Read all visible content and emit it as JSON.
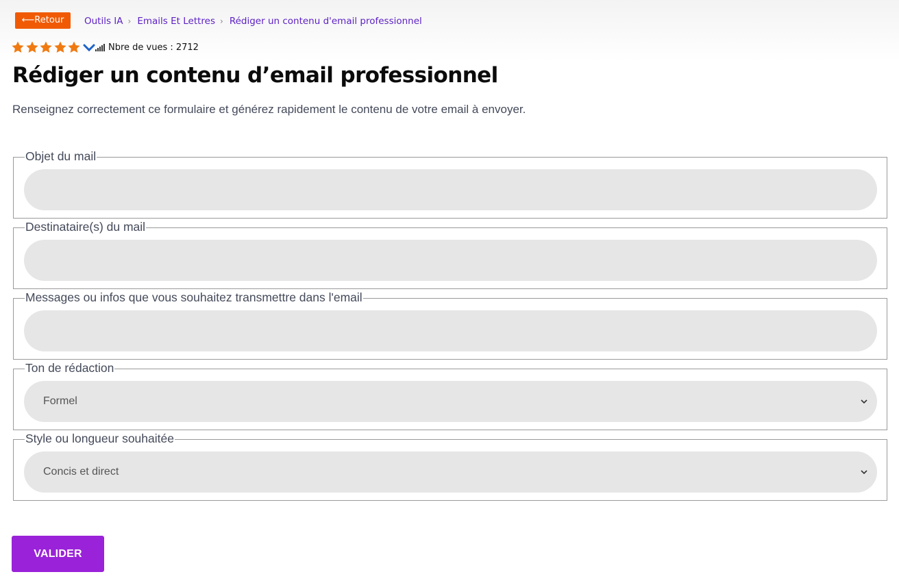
{
  "nav": {
    "back_label": "⟵Retour",
    "breadcrumb": [
      {
        "label": "Outils IA"
      },
      {
        "label": "Emails Et Lettres"
      },
      {
        "label": "Rédiger un contenu d'email professionnel"
      }
    ],
    "separator": "›"
  },
  "rating": {
    "stars": 5,
    "views_label": "Nbre de vues : 2712",
    "star_color": "#f07a12",
    "icons": [
      "star-icon",
      "chevron-down-icon",
      "signal-bars-icon"
    ]
  },
  "page": {
    "title": "Rédiger un contenu d’email professionnel",
    "intro": "Renseignez correctement ce formulaire et générez rapidement le contenu de votre email à envoyer."
  },
  "form": {
    "fields": [
      {
        "legend": "Objet du mail",
        "type": "text",
        "value": ""
      },
      {
        "legend": "Destinataire(s) du mail",
        "type": "text",
        "value": ""
      },
      {
        "legend": "Messages ou infos que vous souhaitez transmettre dans l'email",
        "type": "text",
        "value": ""
      },
      {
        "legend": "Ton de rédaction",
        "type": "select",
        "value": "Formel"
      },
      {
        "legend": "Style ou longueur souhaitée",
        "type": "select",
        "value": "Concis et direct"
      }
    ],
    "submit_label": "VALIDER",
    "submit_color": "#9a22d9",
    "back_color": "#f05a05",
    "link_color": "#5b1fc4"
  }
}
